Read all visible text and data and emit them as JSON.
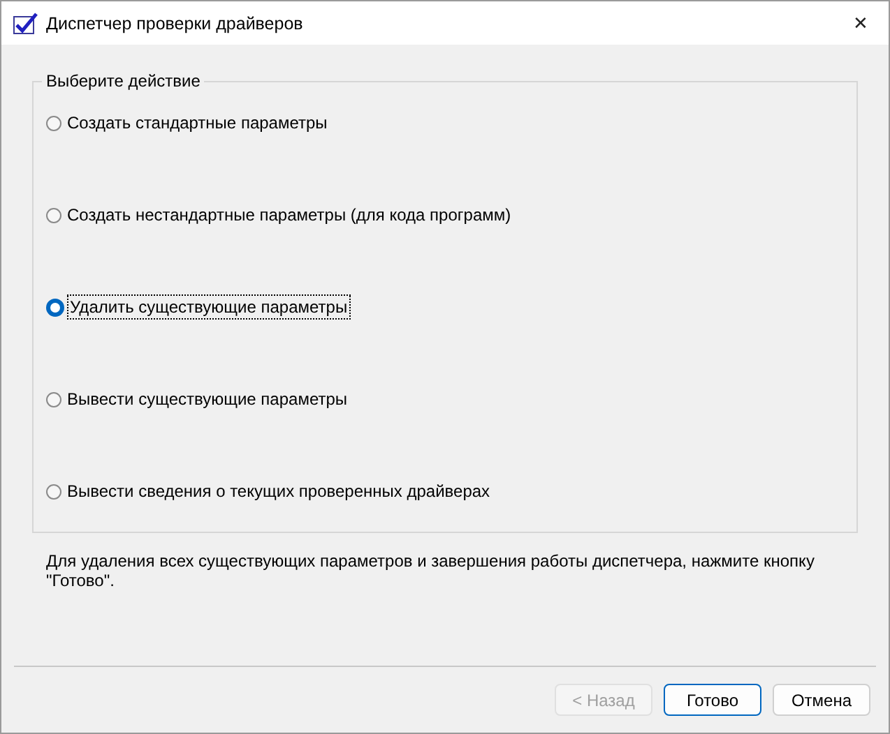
{
  "window": {
    "title": "Диспетчер проверки драйверов",
    "close": "✕"
  },
  "group": {
    "title": "Выберите действие",
    "options": [
      {
        "label": "Создать стандартные параметры",
        "selected": false
      },
      {
        "label": "Создать нестандартные параметры (для кода программ)",
        "selected": false
      },
      {
        "label": "Удалить существующие параметры",
        "selected": true
      },
      {
        "label": "Вывести существующие параметры",
        "selected": false
      },
      {
        "label": "Вывести сведения о текущих проверенных драйверах",
        "selected": false
      }
    ]
  },
  "description": "Для удаления всех существующих параметров и завершения работы диспетчера, нажмите кнопку \"Готово\".",
  "buttons": [
    {
      "label": "< Назад",
      "disabled": true,
      "default": false
    },
    {
      "label": "Готово",
      "disabled": false,
      "default": true
    },
    {
      "label": "Отмена",
      "disabled": false,
      "default": false
    }
  ]
}
